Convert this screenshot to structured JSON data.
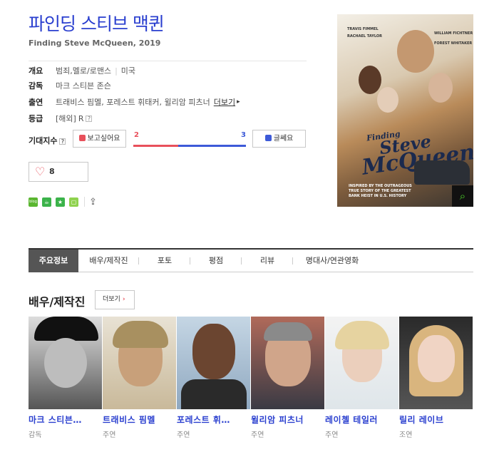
{
  "movie": {
    "title": "파인딩 스티브 맥퀸",
    "subtitle": "Finding Steve McQueen, 2019"
  },
  "info": {
    "genre_label": "개요",
    "genres": [
      "범죄",
      "멜로/로맨스"
    ],
    "country": "미국",
    "director_label": "감독",
    "director": "마크 스티븐 존슨",
    "cast_label": "출연",
    "cast": "트래비스 핌멜, 포레스트 휘태커, 윌리암 피츠너",
    "cast_more": "더보기",
    "rating_label": "등급",
    "rating_region": "[해외]",
    "rating": "R",
    "help_mark": "?"
  },
  "expect": {
    "label": "기대지수",
    "want_label": "보고싶어요",
    "want_count": "2",
    "bad_label": "글쎄요",
    "bad_count": "3",
    "want_fraction": 0.4
  },
  "like": {
    "count": "8"
  },
  "share": {
    "icons": [
      "blog-icon",
      "cafe-icon",
      "bookmark-icon",
      "memo-icon",
      "share-icon"
    ],
    "blog_text": "blog"
  },
  "poster": {
    "names_left": "TRAVIS FIMMEL",
    "names_left2": "RACHAEL TAYLOR",
    "names_right": "WILLIAM FICHTNER",
    "names_right2": "FOREST WHITAKER",
    "title_finding": "Finding",
    "title_steve": "Steve",
    "title_mcqueen": "McQueen",
    "tagline": "INSPIRED BY THE OUTRAGEOUS TRUE STORY OF THE GREATEST BANK HEIST IN U.S. HISTORY"
  },
  "tabs": [
    "주요정보",
    "배우/제작진",
    "포토",
    "평점",
    "리뷰",
    "명대사/연관영화"
  ],
  "section": {
    "title": "배우/제작진",
    "more": "더보기"
  },
  "people": [
    {
      "name": "마크 스티븐…",
      "role": "감독"
    },
    {
      "name": "트래비스 핌멜",
      "role": "주연"
    },
    {
      "name": "포레스트 휘…",
      "role": "주연"
    },
    {
      "name": "윌리암 피츠너",
      "role": "주연"
    },
    {
      "name": "레이첼 테일러",
      "role": "주연"
    },
    {
      "name": "릴리 레이브",
      "role": "조연"
    }
  ],
  "colors": {
    "title_blue": "#2a3fcf",
    "want_red": "#e8505b",
    "bad_blue": "#3d5ad8"
  }
}
